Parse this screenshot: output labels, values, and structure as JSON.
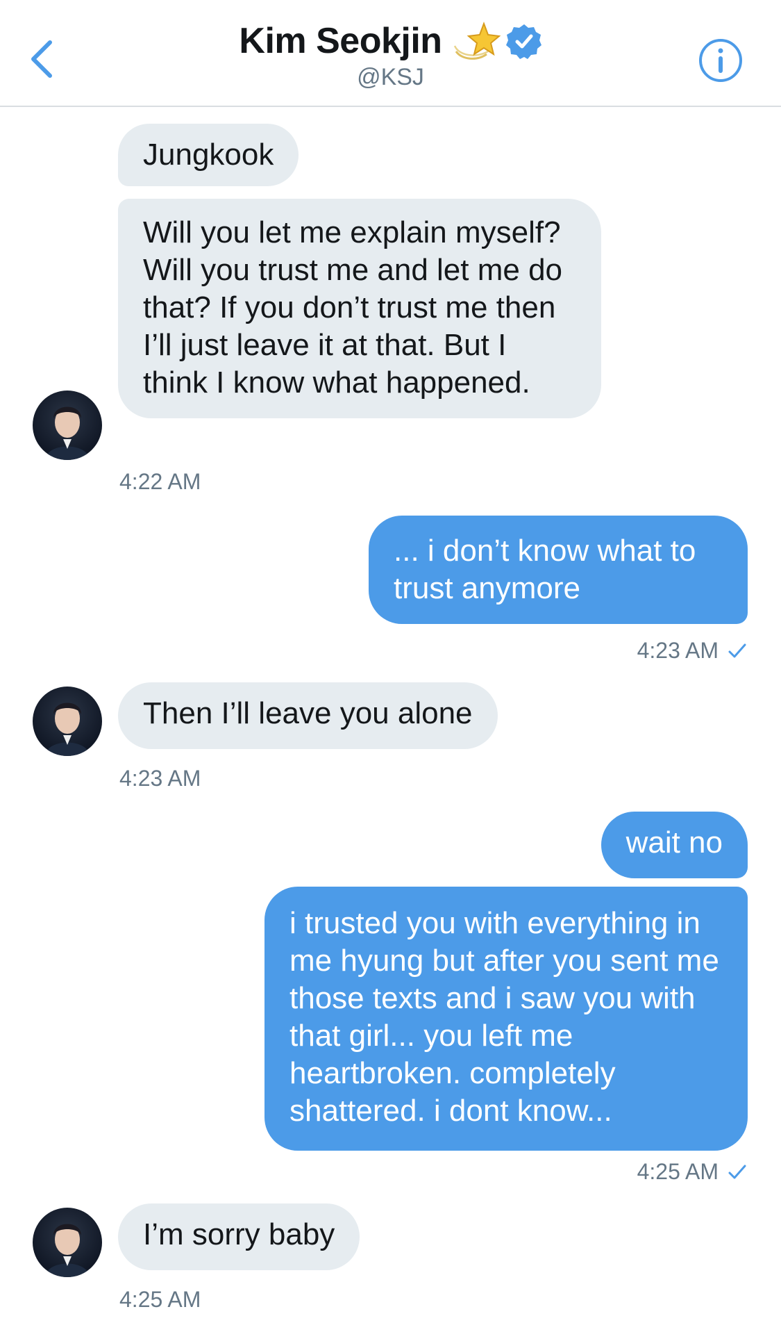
{
  "header": {
    "name": "Kim Seokjin",
    "handle": "@KSJ"
  },
  "colors": {
    "accent": "#4c9be8",
    "incoming_bubble": "#e6ecf0",
    "timestamp": "#657786"
  },
  "icons": {
    "back": "chevron-left-icon",
    "emoji": "dizzy-star-emoji",
    "verified": "verified-badge-icon",
    "info": "info-icon",
    "read": "checkmark-icon"
  },
  "messages": [
    {
      "direction": "in",
      "text": "Jungkook"
    },
    {
      "direction": "in",
      "text": "Will you let me explain myself? Will you trust me and let me do that? If you don’t trust me then I’ll just leave it at that. But I think I know what happened."
    },
    {
      "direction": "in",
      "timestamp": "4:22 AM"
    },
    {
      "direction": "out",
      "text": "... i don’t know what to trust anymore",
      "timestamp": "4:23 AM"
    },
    {
      "direction": "in",
      "text": "Then I’ll leave you alone",
      "timestamp": "4:23 AM"
    },
    {
      "direction": "out",
      "text": "wait no"
    },
    {
      "direction": "out",
      "text": "i trusted you with everything in me hyung but after you sent me those texts and i saw you with that girl... you left me heartbroken. completely shattered. i dont know...",
      "timestamp": "4:25 AM"
    },
    {
      "direction": "in",
      "text": "I’m sorry baby",
      "timestamp": "4:25 AM"
    }
  ]
}
